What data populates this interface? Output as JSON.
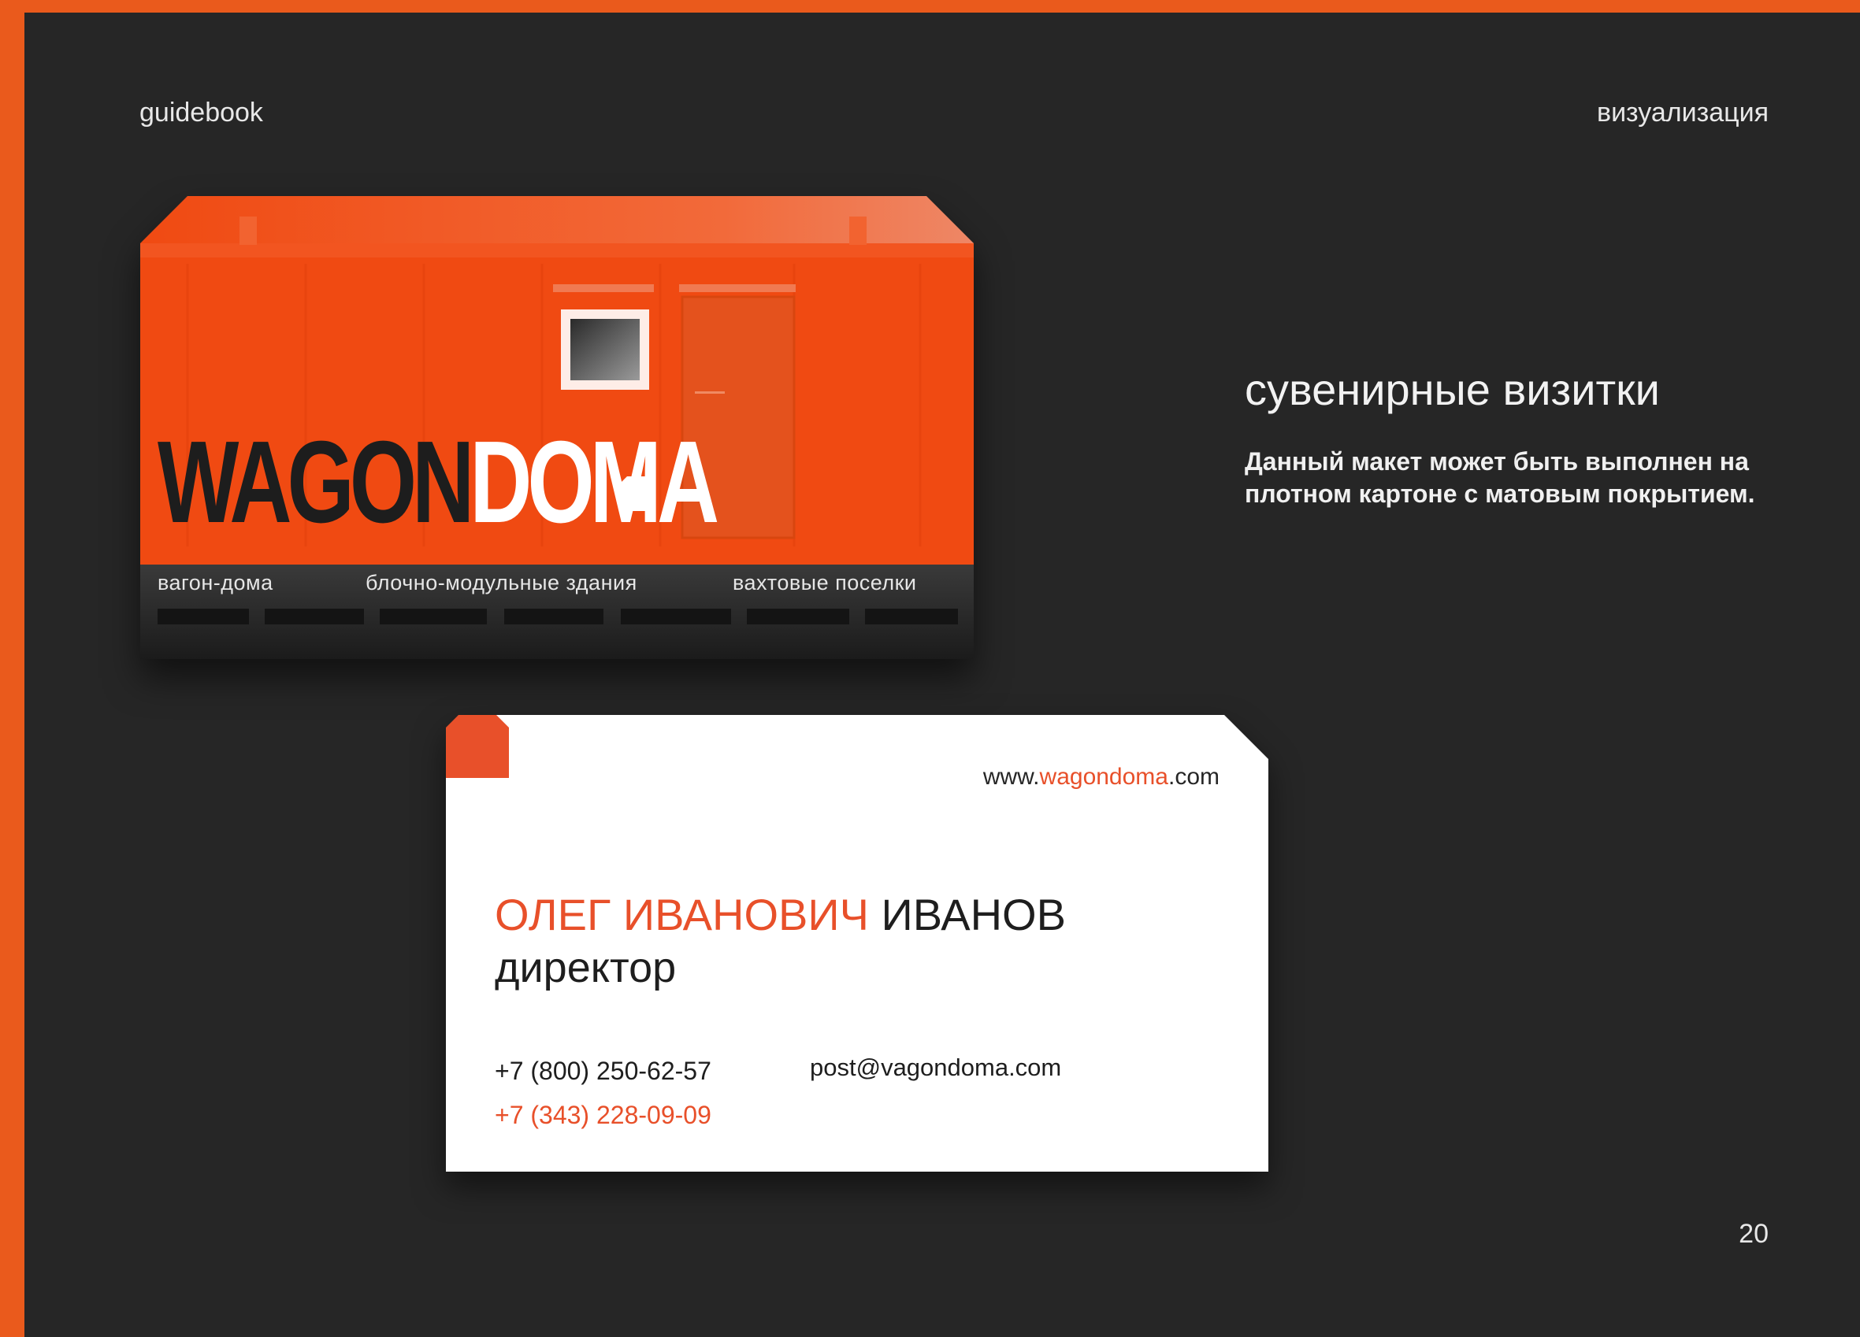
{
  "header": {
    "left": "guidebook",
    "right": "визуализация"
  },
  "info": {
    "title": "сувенирные визитки",
    "text": "Данный макет может быть выполнен на плотном картоне с матовым покрытием."
  },
  "front_card": {
    "brand_dark": "WAGON",
    "brand_light": "DOMA",
    "labels": [
      "вагон-дома",
      "блочно-модульные здания",
      "вахтовые поселки"
    ],
    "color": "#f04a12"
  },
  "back_card": {
    "site_prefix": "www.",
    "site_accent": "wagondoma",
    "site_suffix": ".com",
    "name_accent": "ОЛЕГ ИВАНОВИЧ",
    "name_rest": " ИВАНОВ",
    "position": "директор",
    "phone1": "+7 (800) 250-62-57",
    "phone2": "+7 (343) 228-09-09",
    "email": "post@vagondoma.com",
    "accent_color": "#e8502a"
  },
  "page_number": "20"
}
